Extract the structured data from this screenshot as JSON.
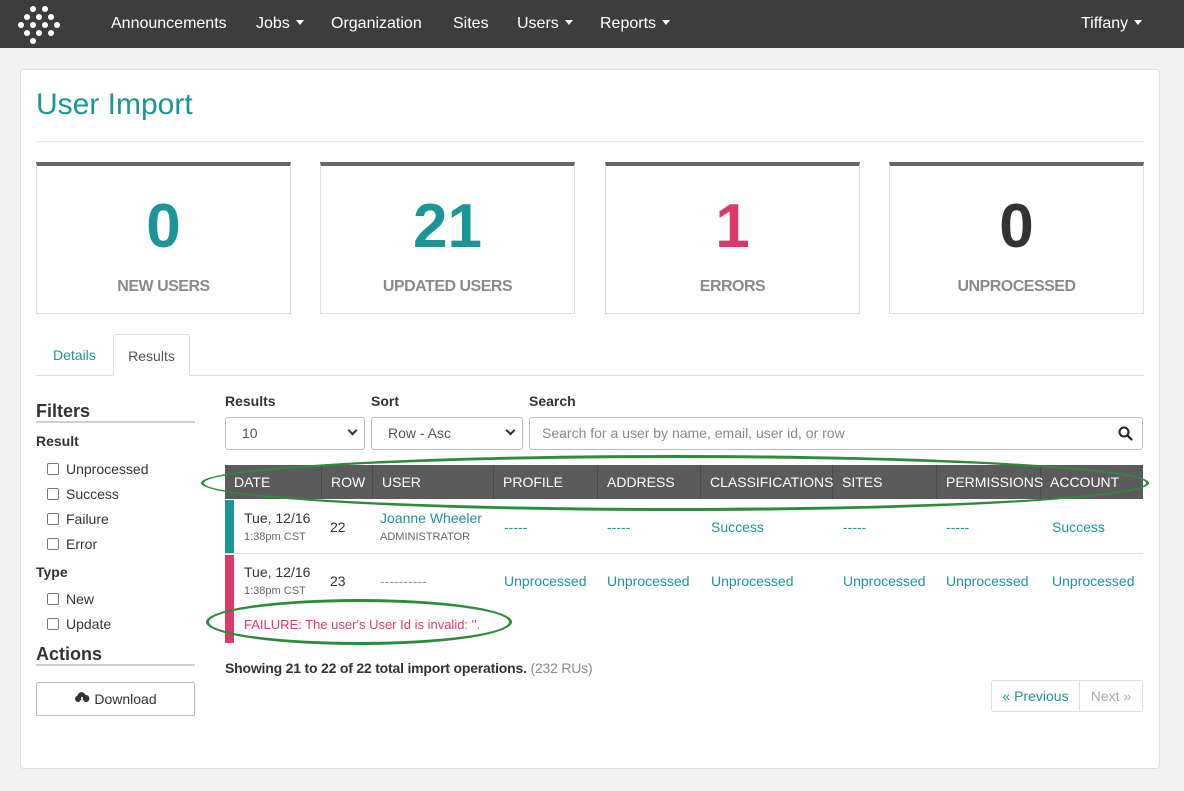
{
  "nav": {
    "items": [
      {
        "label": "Announcements",
        "caret": false
      },
      {
        "label": "Jobs",
        "caret": true
      },
      {
        "label": "Organization",
        "caret": false
      },
      {
        "label": "Sites",
        "caret": false
      },
      {
        "label": "Users",
        "caret": true
      },
      {
        "label": "Reports",
        "caret": true
      }
    ],
    "user": "Tiffany"
  },
  "page": {
    "title": "User Import"
  },
  "stats": [
    {
      "value": "0",
      "label": "NEW USERS",
      "color": "#1b9596"
    },
    {
      "value": "21",
      "label": "UPDATED USERS",
      "color": "#1b9596"
    },
    {
      "value": "1",
      "label": "ERRORS",
      "color": "#d93a6a"
    },
    {
      "value": "0",
      "label": "UNPROCESSED",
      "color": "#333333"
    }
  ],
  "tabs": [
    {
      "label": "Details",
      "active": false
    },
    {
      "label": "Results",
      "active": true
    }
  ],
  "sidebar": {
    "filters_heading": "Filters",
    "result_heading": "Result",
    "result_options": [
      "Unprocessed",
      "Success",
      "Failure",
      "Error"
    ],
    "type_heading": "Type",
    "type_options": [
      "New",
      "Update"
    ],
    "actions_heading": "Actions",
    "download_label": "Download",
    "download_icon": "cloud-download-icon"
  },
  "controls": {
    "results_label": "Results",
    "results_value": "10",
    "sort_label": "Sort",
    "sort_value": "Row - Asc",
    "search_label": "Search",
    "search_placeholder": "Search for a user by name, email, user id, or row"
  },
  "table": {
    "headers": [
      "DATE",
      "ROW",
      "USER",
      "PROFILE",
      "ADDRESS",
      "CLASSIFICATIONS",
      "SITES",
      "PERMISSIONS",
      "ACCOUNT"
    ],
    "rows": [
      {
        "status_color": "#1b9596",
        "date": "Tue, 12/16",
        "time": "1:38pm CST",
        "row": "22",
        "user_name": "Joanne Wheeler",
        "user_role": "ADMINISTRATOR",
        "profile": "-----",
        "address": "-----",
        "classifications": "Success",
        "sites": "-----",
        "permissions": "-----",
        "account": "Success"
      },
      {
        "status_color": "#d93a6a",
        "date": "Tue, 12/16",
        "time": "1:38pm CST",
        "row": "23",
        "user_name": "----------",
        "profile": "Unprocessed",
        "address": "Unprocessed",
        "classifications": "Unprocessed",
        "sites": "Unprocessed",
        "permissions": "Unprocessed",
        "account": "Unprocessed",
        "message": "FAILURE: The user's User Id is invalid: ''."
      }
    ]
  },
  "summary": {
    "text": "Showing 21 to 22 of 22 total import operations.",
    "ru": "(232 RUs)"
  },
  "pagination": {
    "previous": "« Previous",
    "next": "Next »"
  }
}
